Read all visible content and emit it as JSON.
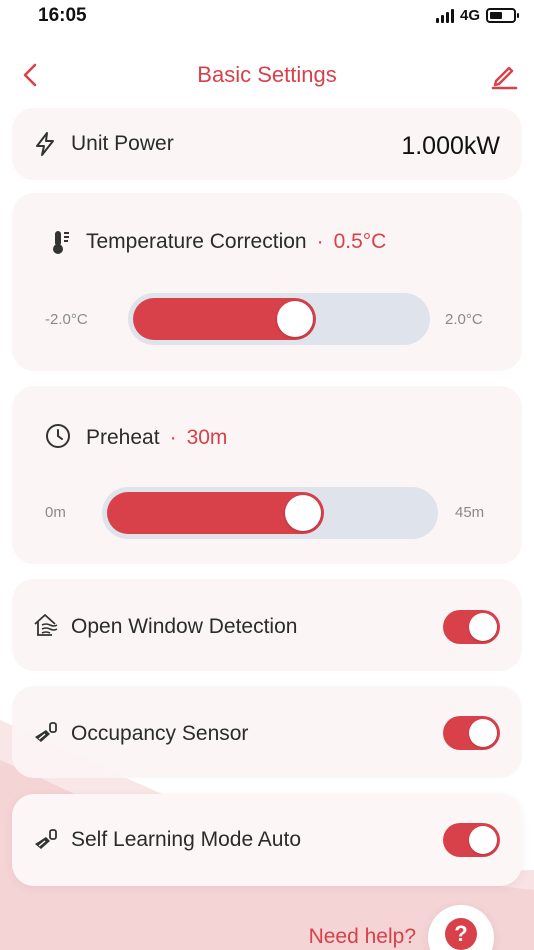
{
  "status_bar": {
    "time": "16:05",
    "network": "4G"
  },
  "nav": {
    "title": "Basic Settings",
    "back_icon": "chevron-left-icon",
    "edit_icon": "pencil-icon"
  },
  "unit_power": {
    "label": "Unit Power",
    "value": "1.000kW",
    "icon": "lightning-icon"
  },
  "temperature_correction": {
    "label": "Temperature Correction",
    "value": "0.5°C",
    "min_label": "-2.0°C",
    "max_label": "2.0°C",
    "min": -2.0,
    "max": 2.0,
    "current": 0.5,
    "icon": "thermometer-icon"
  },
  "preheat": {
    "label": "Preheat",
    "value": "30m",
    "min_label": "0m",
    "max_label": "45m",
    "min": 0,
    "max": 45,
    "current": 30,
    "icon": "clock-icon"
  },
  "toggles": [
    {
      "label": "Open Window Detection",
      "on": true,
      "icon": "open-window-icon"
    },
    {
      "label": "Occupancy Sensor",
      "on": true,
      "icon": "occupancy-sensor-icon"
    },
    {
      "label": "Self Learning Mode Auto",
      "on": true,
      "icon": "self-learning-icon"
    }
  ],
  "help": {
    "label": "Need help?",
    "glyph": "?"
  },
  "colors": {
    "accent": "#d9414a",
    "track": "#dfe3ec",
    "card": "#fcf4f4"
  }
}
